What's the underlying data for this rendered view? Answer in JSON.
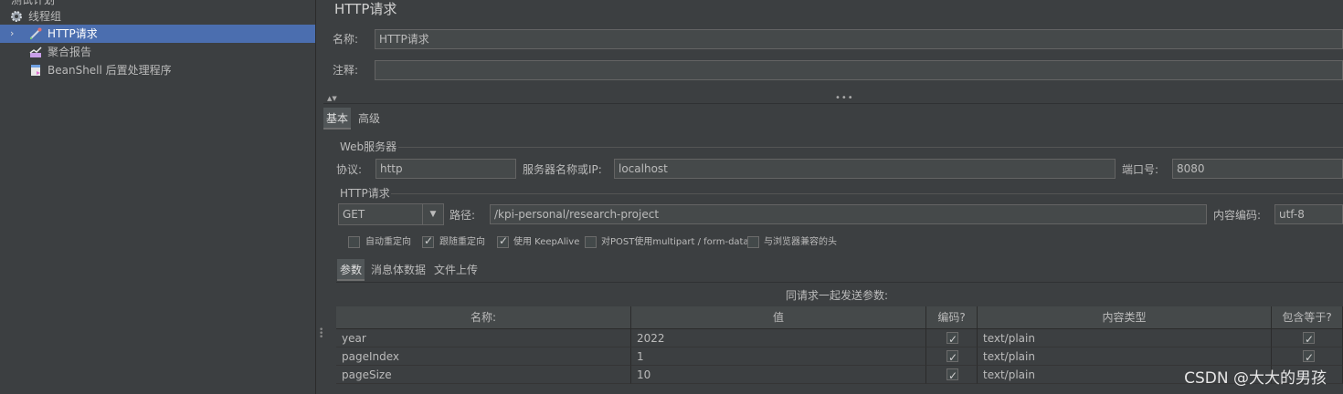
{
  "tree": {
    "items": [
      {
        "label": "测试计划"
      },
      {
        "label": "线程组"
      },
      {
        "label": "HTTP请求"
      },
      {
        "label": "聚合报告"
      },
      {
        "label": "BeanShell 后置处理程序"
      }
    ]
  },
  "panel": {
    "title": "HTTP请求",
    "name_label": "名称:",
    "name_value": "HTTP请求",
    "comment_label": "注释:",
    "comment_value": "",
    "tabs": [
      {
        "label": "基本"
      },
      {
        "label": "高级"
      }
    ],
    "web_server": {
      "group_title": "Web服务器",
      "protocol_label": "协议:",
      "protocol_value": "http",
      "server_label": "服务器名称或IP:",
      "server_value": "localhost",
      "port_label": "端口号:",
      "port_value": "8080"
    },
    "http_request": {
      "group_title": "HTTP请求",
      "method": "GET",
      "path_label": "路径:",
      "path_value": "/kpi-personal/research-project",
      "encoding_label": "内容编码:",
      "encoding_value": "utf-8"
    },
    "options": [
      {
        "label": "自动重定向",
        "checked": false
      },
      {
        "label": "跟随重定向",
        "checked": true
      },
      {
        "label": "使用 KeepAlive",
        "checked": true
      },
      {
        "label": "对POST使用multipart / form-data",
        "checked": false
      },
      {
        "label": "与浏览器兼容的头",
        "checked": false
      }
    ],
    "sub_tabs": [
      {
        "label": "参数"
      },
      {
        "label": "消息体数据"
      },
      {
        "label": "文件上传"
      }
    ],
    "params_caption": "同请求一起发送参数:",
    "table": {
      "headers": [
        "名称:",
        "值",
        "编码?",
        "内容类型",
        "包含等于?"
      ],
      "rows": [
        {
          "name": "year",
          "value": "2022",
          "encode": true,
          "content_type": "text/plain",
          "include_equals": true
        },
        {
          "name": "pageIndex",
          "value": "1",
          "encode": true,
          "content_type": "text/plain",
          "include_equals": true
        },
        {
          "name": "pageSize",
          "value": "10",
          "encode": true,
          "content_type": "text/plain",
          "include_equals": true
        }
      ]
    }
  },
  "watermark": "CSDN @大大的男孩",
  "colors": {
    "selection": "#4b6eaf",
    "background": "#3c3f41",
    "field": "#45494a"
  }
}
